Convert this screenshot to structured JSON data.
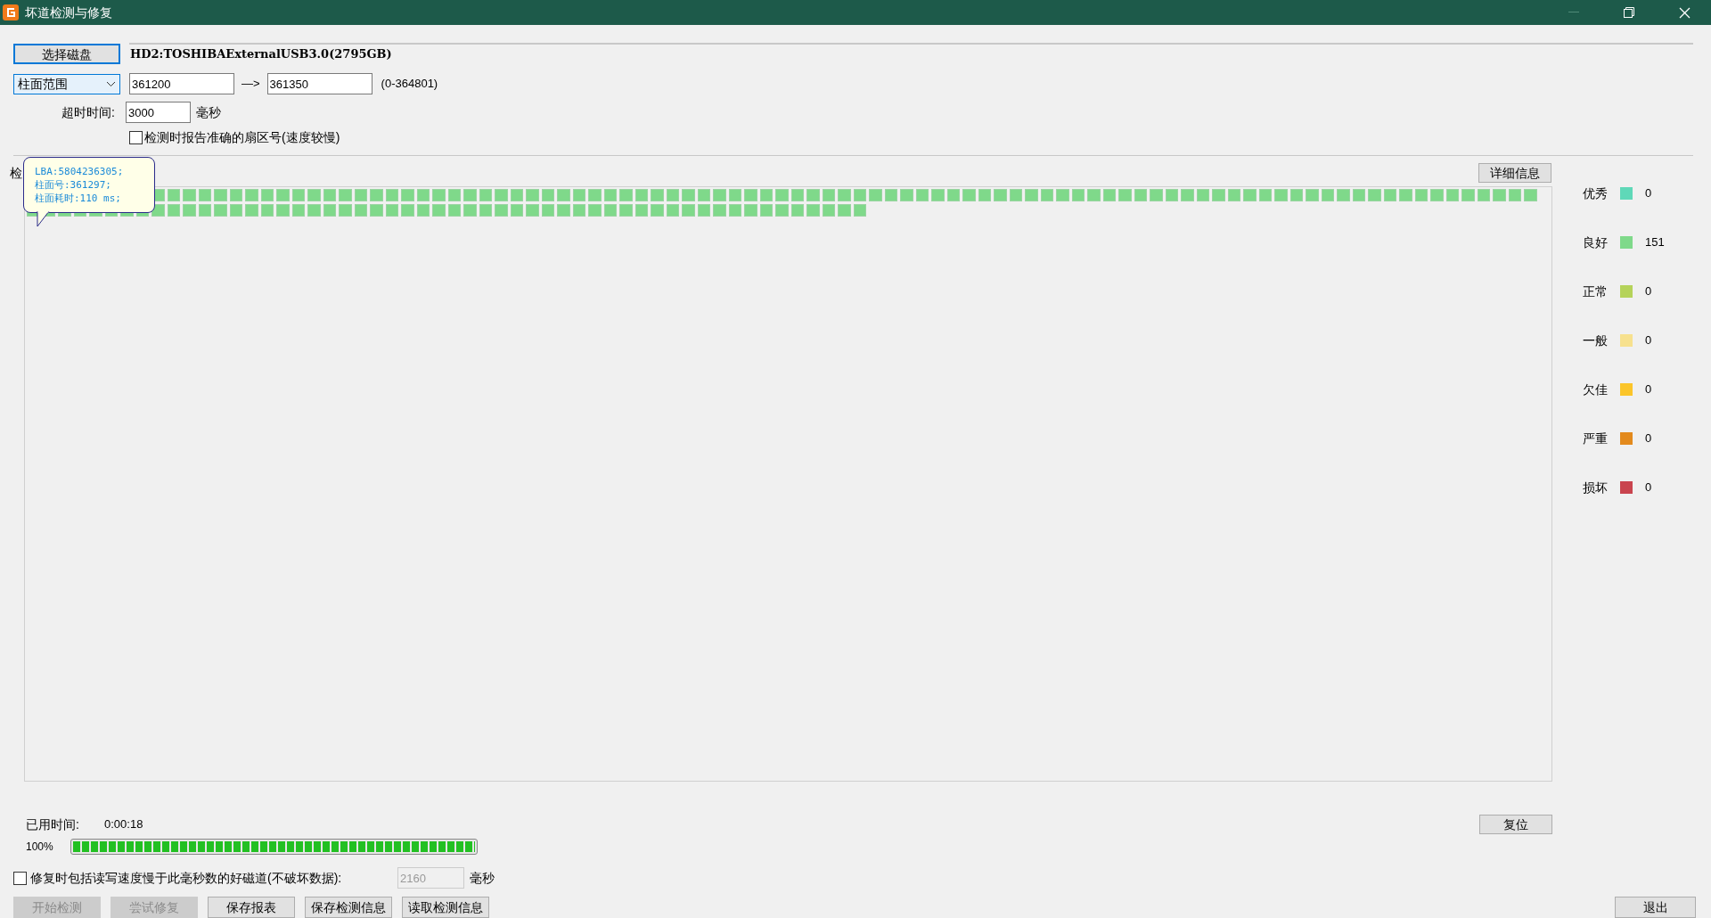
{
  "window": {
    "title": "坏道检测与修复"
  },
  "disk": {
    "button": "选择磁盘",
    "value": "HD2:TOSHIBAExternalUSB3.0(2795GB)"
  },
  "range": {
    "mode": "柱面范围",
    "from": "361200",
    "arrow": "—>",
    "to": "361350",
    "limits": "(0-364801)"
  },
  "timeout": {
    "label": "超时时间:",
    "value": "3000",
    "unit": "毫秒"
  },
  "exact_sector": {
    "label": "检测时报告准确的扇区号(速度较慢)",
    "checked": false
  },
  "group_label": "检",
  "tooltip": {
    "lines": [
      "LBA:5804236305;",
      "柱面号:361297;",
      "柱面耗时:110 ms;"
    ]
  },
  "details_button": "详细信息",
  "legend": [
    {
      "label": "优秀",
      "color": "#5fd8b8",
      "count": "0"
    },
    {
      "label": "良好",
      "color": "#7fd98a",
      "count": "151"
    },
    {
      "label": "正常",
      "color": "#b5d35a",
      "count": "0"
    },
    {
      "label": "一般",
      "color": "#f7e18e",
      "count": "0"
    },
    {
      "label": "欠佳",
      "color": "#fbc52a",
      "count": "0"
    },
    {
      "label": "严重",
      "color": "#e38a1d",
      "count": "0"
    },
    {
      "label": "损坏",
      "color": "#c9444e",
      "count": "0"
    }
  ],
  "elapsed": {
    "label": "已用时间:",
    "value": "0:00:18"
  },
  "reset_button": "复位",
  "progress": {
    "label": "100%",
    "level": 1
  },
  "repair_slow": {
    "label": "修复时包括读写速度慢于此毫秒数的好磁道(不破坏数据):",
    "checked": false,
    "value": "2160",
    "unit": "毫秒",
    "disabled": true
  },
  "buttons": [
    {
      "label": "开始检测",
      "disabled": true
    },
    {
      "label": "尝试修复",
      "disabled": true
    },
    {
      "label": "保存报表",
      "disabled": false
    },
    {
      "label": "保存检测信息",
      "disabled": false
    },
    {
      "label": "读取检测信息",
      "disabled": false
    }
  ],
  "exit_button": "退出"
}
